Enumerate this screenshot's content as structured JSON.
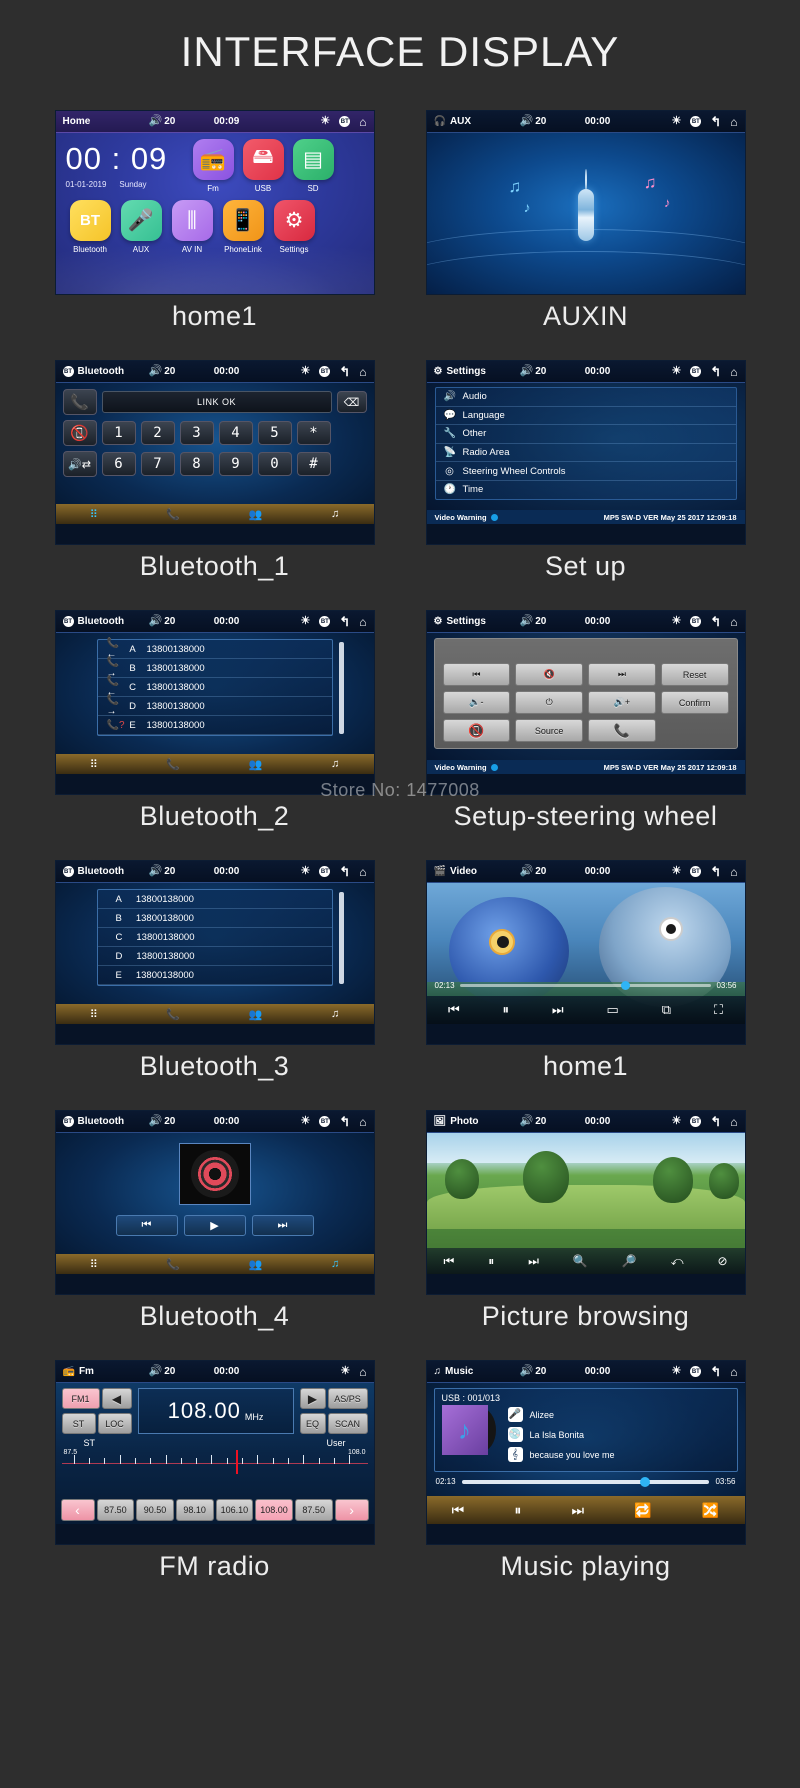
{
  "page": {
    "title": "INTERFACE DISPLAY",
    "watermark": "Store No: 1477008"
  },
  "status_common": {
    "volume": "20",
    "time_zero": "00:00",
    "time_home": "00:09"
  },
  "screens": [
    {
      "caption": "home1",
      "status": {
        "title": "Home",
        "volume": "20",
        "time": "00:09"
      },
      "clock": {
        "time": "00 : 09",
        "date": "01-01-2019",
        "weekday": "Sunday"
      },
      "tiles_row1": [
        {
          "label": "Fm",
          "icon": "radio-icon"
        },
        {
          "label": "USB",
          "icon": "usb-icon"
        },
        {
          "label": "SD",
          "icon": "sdcard-icon"
        }
      ],
      "tiles_row2": [
        {
          "label": "Bluetooth",
          "icon": "bt-icon"
        },
        {
          "label": "AUX",
          "icon": "aux-plug-icon"
        },
        {
          "label": "AV IN",
          "icon": "rca-icon"
        },
        {
          "label": "PhoneLink",
          "icon": "phonelink-icon"
        },
        {
          "label": "Settings",
          "icon": "gear-icon"
        }
      ]
    },
    {
      "caption": "AUXIN",
      "status": {
        "title": "AUX",
        "volume": "20",
        "time": "00:00"
      }
    },
    {
      "caption": "Bluetooth_1",
      "status": {
        "title": "Bluetooth",
        "volume": "20",
        "time": "00:00"
      },
      "link_status": "LINK OK",
      "keys": [
        "1",
        "2",
        "3",
        "4",
        "5",
        "*",
        "6",
        "7",
        "8",
        "9",
        "0",
        "#"
      ],
      "footer_icons": [
        "keypad-icon",
        "call-log-icon",
        "contacts-icon",
        "bt-music-icon"
      ]
    },
    {
      "caption": "Set up",
      "status": {
        "title": "Settings",
        "volume": "20",
        "time": "00:00"
      },
      "menu": [
        {
          "label": "Audio",
          "icon": "speaker-icon"
        },
        {
          "label": "Language",
          "icon": "chat-icon"
        },
        {
          "label": "Other",
          "icon": "wrench-icon"
        },
        {
          "label": "Radio Area",
          "icon": "antenna-icon"
        },
        {
          "label": "Steering Wheel Controls",
          "icon": "steering-icon"
        },
        {
          "label": "Time",
          "icon": "clock-icon"
        }
      ],
      "footer": {
        "warning": "Video Warning",
        "version": "MP5 SW-D VER May 25 2017 12:09:18"
      }
    },
    {
      "caption": "Bluetooth_2",
      "status": {
        "title": "Bluetooth",
        "volume": "20",
        "time": "00:00"
      },
      "calls": [
        {
          "type": "incoming",
          "key": "A",
          "number": "13800138000"
        },
        {
          "type": "outgoing",
          "key": "B",
          "number": "13800138000"
        },
        {
          "type": "incoming",
          "key": "C",
          "number": "13800138000"
        },
        {
          "type": "outgoing",
          "key": "D",
          "number": "13800138000"
        },
        {
          "type": "missed",
          "key": "E",
          "number": "13800138000"
        }
      ],
      "footer_icons": [
        "keypad-icon",
        "call-log-icon",
        "contacts-icon",
        "bt-music-icon"
      ]
    },
    {
      "caption": "Setup-steering wheel",
      "status": {
        "title": "Settings",
        "volume": "20",
        "time": "00:00"
      },
      "buttons": [
        {
          "label": "",
          "icon": "prev-track-icon"
        },
        {
          "label": "",
          "icon": "mute-icon"
        },
        {
          "label": "",
          "icon": "next-track-icon"
        },
        {
          "label": "Reset",
          "icon": ""
        },
        {
          "label": "",
          "icon": "volume-down-icon"
        },
        {
          "label": "",
          "icon": "power-icon"
        },
        {
          "label": "",
          "icon": "volume-up-icon"
        },
        {
          "label": "Confirm",
          "icon": ""
        },
        {
          "label": "",
          "icon": "hangup-icon"
        },
        {
          "label": "Source",
          "icon": ""
        },
        {
          "label": "",
          "icon": "call-icon"
        }
      ],
      "footer": {
        "warning": "Video Warning",
        "version": "MP5 SW-D VER May 25 2017 12:09:18"
      }
    },
    {
      "caption": "Bluetooth_3",
      "status": {
        "title": "Bluetooth",
        "volume": "20",
        "time": "00:00"
      },
      "contacts": [
        {
          "key": "A",
          "number": "13800138000"
        },
        {
          "key": "B",
          "number": "13800138000"
        },
        {
          "key": "C",
          "number": "13800138000"
        },
        {
          "key": "D",
          "number": "13800138000"
        },
        {
          "key": "E",
          "number": "13800138000"
        }
      ],
      "footer_icons": [
        "keypad-icon",
        "call-log-icon",
        "contacts-icon",
        "bt-music-icon"
      ]
    },
    {
      "caption": "home1",
      "status": {
        "title": "Video",
        "volume": "20",
        "time": "00:00"
      },
      "player": {
        "elapsed": "02:13",
        "total": "03:56"
      },
      "controls": [
        "prev-icon",
        "pause-icon",
        "next-icon",
        "subtitle-icon",
        "aspect-icon",
        "fullscreen-icon"
      ]
    },
    {
      "caption": "Bluetooth_4",
      "status": {
        "title": "Bluetooth",
        "volume": "20",
        "time": "00:00"
      },
      "controls": [
        "prev-icon",
        "play-icon",
        "next-icon"
      ],
      "footer_icons": [
        "keypad-icon",
        "call-log-icon",
        "contacts-icon",
        "bt-music-icon"
      ]
    },
    {
      "caption": "Picture browsing",
      "status": {
        "title": "Photo",
        "volume": "20",
        "time": "00:00"
      },
      "controls": [
        "prev-icon",
        "pause-icon",
        "next-icon",
        "zoom-in-icon",
        "zoom-out-icon",
        "rotate-icon",
        "stop-icon"
      ]
    },
    {
      "caption": "FM radio",
      "status": {
        "title": "Fm",
        "volume": "20",
        "time": "00:00"
      },
      "band": "FM1",
      "frequency": "108.00",
      "unit": "MHz",
      "buttons": {
        "st": "ST",
        "loc": "LOC",
        "asps": "AS/PS",
        "eq": "EQ",
        "scan": "SCAN"
      },
      "scale": {
        "left": "87.5",
        "right": "108.0",
        "label_left": "ST",
        "label_right": "User"
      },
      "presets": [
        "87.50",
        "90.50",
        "98.10",
        "106.10",
        "108.00",
        "87.50"
      ],
      "selected_preset": "108.00"
    },
    {
      "caption": "Music playing",
      "status": {
        "title": "Music",
        "volume": "20",
        "time": "00:00"
      },
      "source": "USB : 001/013",
      "artist": "Alizee",
      "album": "La Isla Bonita",
      "track": "because you love me",
      "player": {
        "elapsed": "02:13",
        "total": "03:56"
      },
      "controls": [
        "prev-icon",
        "pause-icon",
        "next-icon",
        "repeat-icon",
        "shuffle-icon"
      ]
    }
  ]
}
